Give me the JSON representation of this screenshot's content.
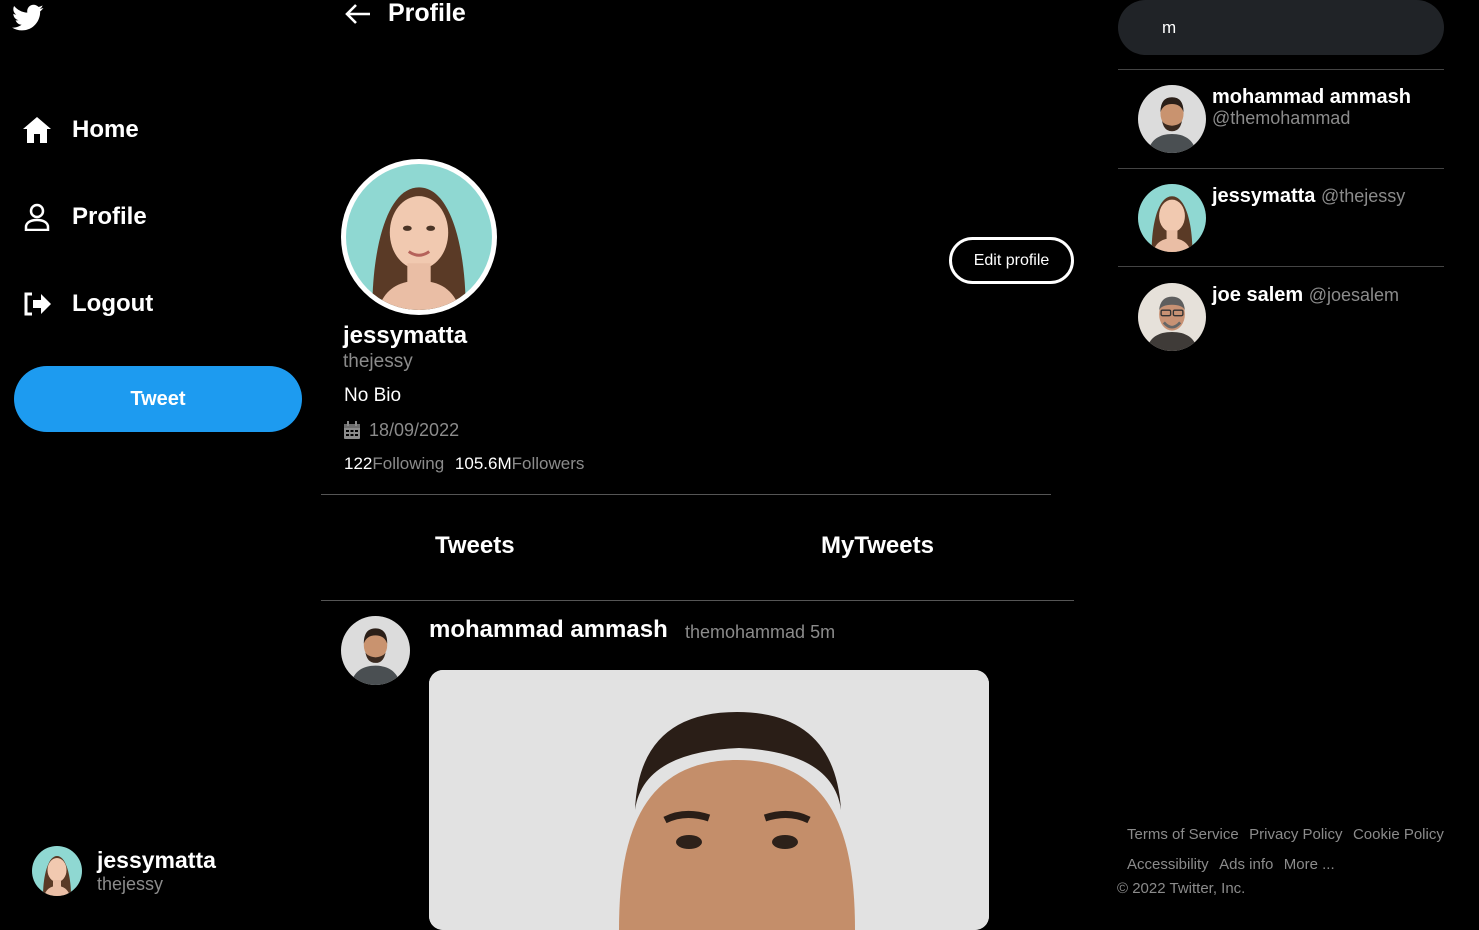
{
  "sidebar": {
    "nav": [
      {
        "label": "Home",
        "icon": "home-icon"
      },
      {
        "label": "Profile",
        "icon": "user-icon"
      },
      {
        "label": "Logout",
        "icon": "logout-icon"
      }
    ],
    "tweet_button": "Tweet",
    "current_user": {
      "name": "jessymatta",
      "handle": "thejessy"
    }
  },
  "header": {
    "title": "Profile"
  },
  "profile": {
    "name": "jessymatta",
    "handle": "thejessy",
    "bio": "No Bio",
    "joined": "18/09/2022",
    "following_count": "122",
    "following_label": "Following",
    "followers_count": "105.6M",
    "followers_label": "Followers",
    "edit_button": "Edit profile"
  },
  "tabs": [
    {
      "label": "Tweets"
    },
    {
      "label": "MyTweets"
    }
  ],
  "tweet": {
    "author_name": "mohammad ammash",
    "author_handle": "themohammad",
    "time": "5m"
  },
  "search": {
    "value": "m"
  },
  "suggestions": [
    {
      "name": "mohammad ammash",
      "handle": "@themohammad"
    },
    {
      "name": "jessymatta",
      "handle": "@thejessy"
    },
    {
      "name": "joe salem",
      "handle": "@joesalem"
    }
  ],
  "footer": {
    "links": [
      "Terms of Service",
      "Privacy Policy",
      "Cookie Policy",
      "Accessibility",
      "Ads info",
      "More ..."
    ],
    "copyright": "© 2022 Twitter, Inc."
  },
  "colors": {
    "accent": "#1d9bf0",
    "background": "#000000",
    "muted": "#8b8b8b"
  }
}
